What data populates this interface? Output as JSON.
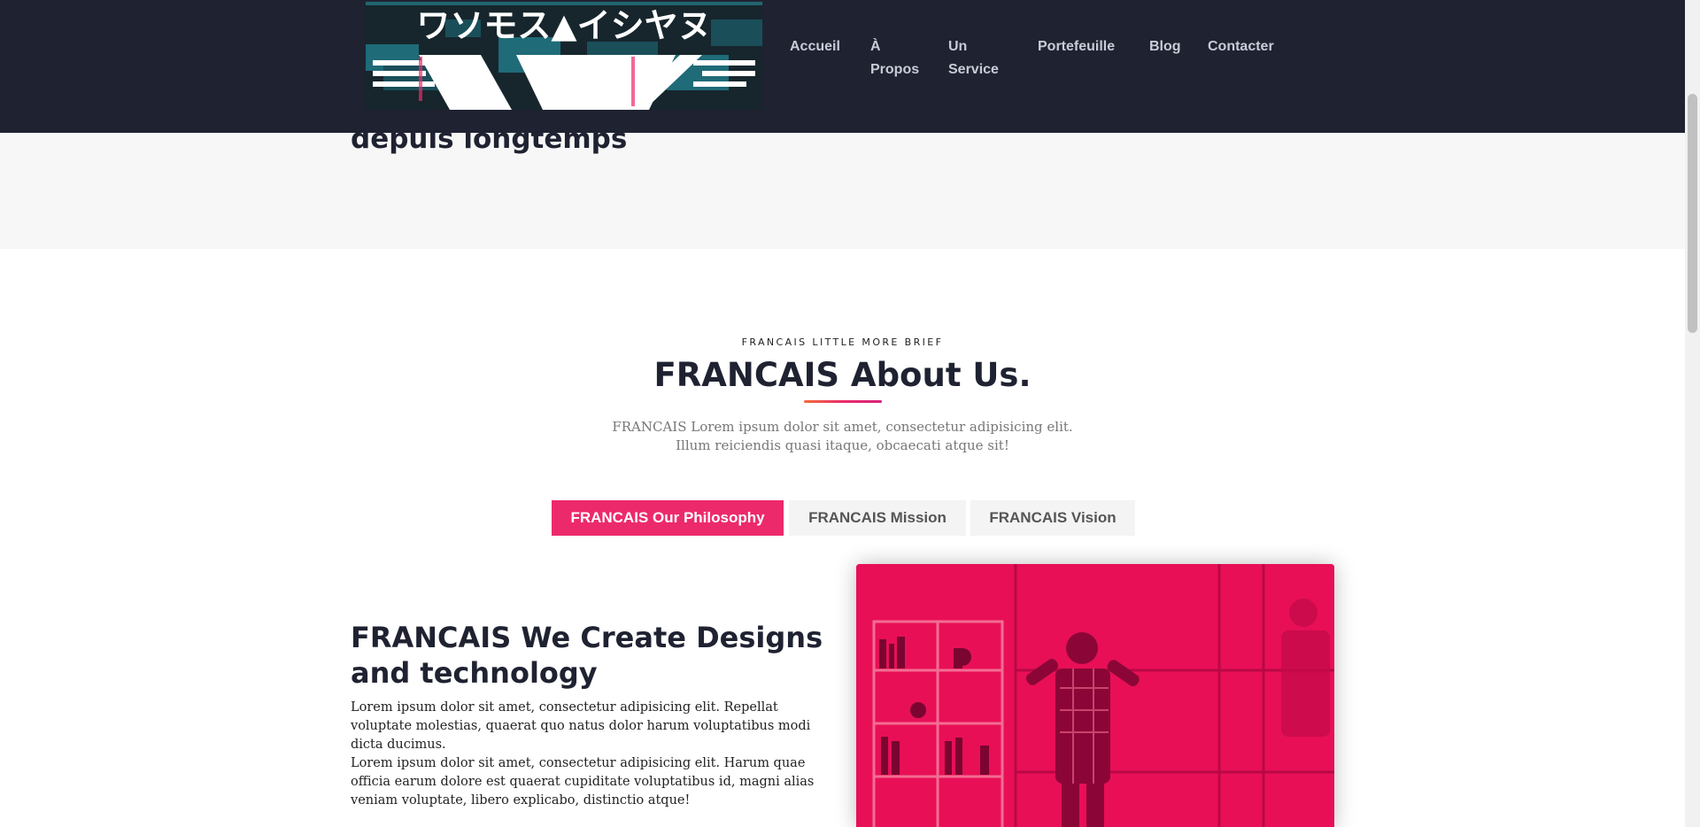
{
  "header": {
    "logo_text": "ワソモス▲イシヤヌ",
    "nav": [
      {
        "label": "Accueil"
      },
      {
        "label": "À Propos"
      },
      {
        "label": "Un Service"
      },
      {
        "label": "Portefeuille"
      },
      {
        "label": "Blog"
      },
      {
        "label": "Contacter"
      }
    ]
  },
  "hero": {
    "title_fragment": "depuis longtemps"
  },
  "about": {
    "kicker": "FRANCAIS LITTLE MORE BRIEF",
    "title": "FRANCAIS About Us.",
    "description": "FRANCAIS Lorem ipsum dolor sit amet, consectetur adipisicing elit. Illum reiciendis quasi itaque, obcaecati atque sit!",
    "accent_color": "#ec2a6b"
  },
  "tabs": [
    {
      "label": "FRANCAIS Our Philosophy",
      "active": true
    },
    {
      "label": "FRANCAIS Mission",
      "active": false
    },
    {
      "label": "FRANCAIS Vision",
      "active": false
    }
  ],
  "content": {
    "title": "FRANCAIS We Create Designs and technology",
    "paragraph_1": "Lorem ipsum dolor sit amet, consectetur adipisicing elit. Repellat voluptate molestias, quaerat quo natus dolor harum voluptatibus modi dicta ducimus.",
    "paragraph_2": "Lorem ipsum dolor sit amet, consectetur adipisicing elit. Harum quae officia earum dolore est quaerat cupiditate voluptatibus id, magni alias veniam voluptate, libero explicabo, distinctio atque!",
    "photo_icon": "office-man-photo"
  },
  "colors": {
    "header_bg": "#1f2231",
    "hero_bg": "#f7f7f7",
    "photo_tint": "#e80f57"
  }
}
